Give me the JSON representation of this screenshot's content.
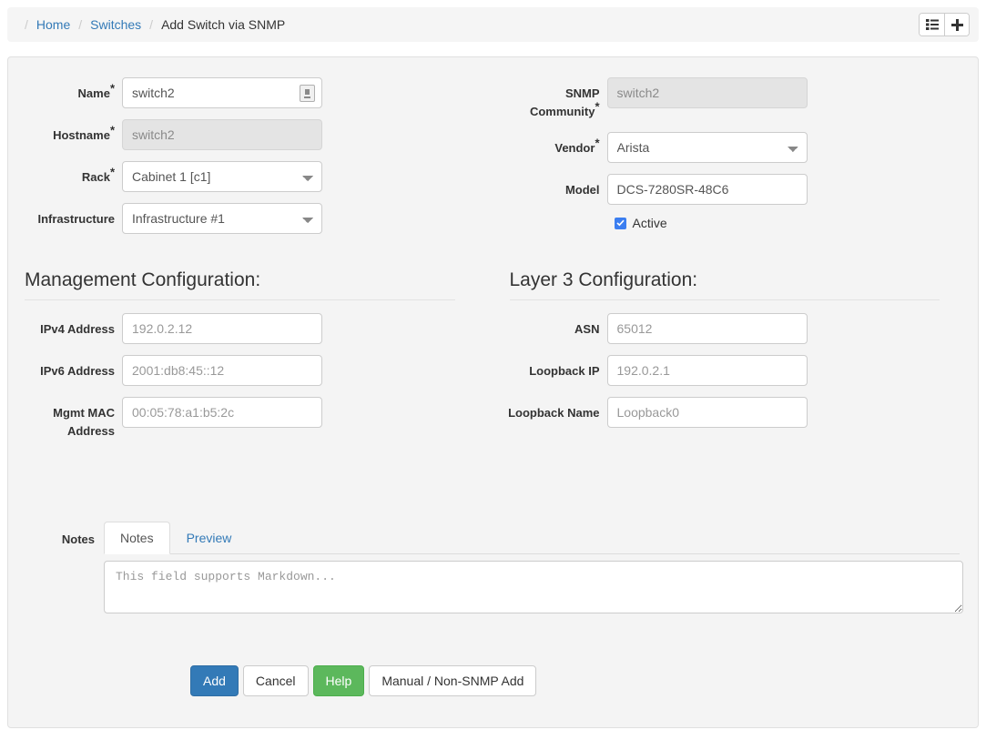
{
  "breadcrumb": {
    "separator": "/",
    "items": [
      {
        "label": "Home",
        "type": "link"
      },
      {
        "label": "Switches",
        "type": "link"
      },
      {
        "label": "Add Switch via SNMP",
        "type": "current"
      }
    ],
    "actions": [
      {
        "name": "list-view-button",
        "icon": "list-icon"
      },
      {
        "name": "add-button",
        "icon": "plus-icon"
      }
    ]
  },
  "form": {
    "left": {
      "name": {
        "label": "Name",
        "required": "*",
        "value": "switch2",
        "placeholder": "",
        "badge_icon": "contact-card-icon"
      },
      "hostname": {
        "label": "Hostname",
        "required": "*",
        "value": "switch2",
        "disabled": true
      },
      "rack": {
        "label": "Rack",
        "required": "*",
        "value": "Cabinet 1 [c1]",
        "options": [
          "Cabinet 1 [c1]"
        ]
      },
      "infrastructure": {
        "label": "Infrastructure",
        "required": "",
        "value": "Infrastructure #1",
        "options": [
          "Infrastructure #1"
        ]
      }
    },
    "right": {
      "snmp_community": {
        "label": "SNMP Community",
        "required": "*",
        "value": "switch2",
        "disabled": true
      },
      "vendor": {
        "label": "Vendor",
        "required": "*",
        "value": "Arista",
        "options": [
          "Arista"
        ]
      },
      "model": {
        "label": "Model",
        "required": "",
        "value": "DCS-7280SR-48C6"
      },
      "active": {
        "label": "Active",
        "checked": true
      }
    }
  },
  "management_section": {
    "title": "Management Configuration:",
    "fields": {
      "ipv4": {
        "label": "IPv4 Address",
        "value": "",
        "placeholder": "192.0.2.12"
      },
      "ipv6": {
        "label": "IPv6 Address",
        "value": "",
        "placeholder": "2001:db8:45::12"
      },
      "mgmt_mac": {
        "label": "Mgmt MAC Address",
        "value": "",
        "placeholder": "00:05:78:a1:b5:2c"
      }
    }
  },
  "layer3_section": {
    "title": "Layer 3 Configuration:",
    "fields": {
      "asn": {
        "label": "ASN",
        "value": "",
        "placeholder": "65012"
      },
      "loopback_ip": {
        "label": "Loopback IP",
        "value": "",
        "placeholder": "192.0.2.1"
      },
      "loopback_name": {
        "label": "Loopback Name",
        "value": "",
        "placeholder": "Loopback0"
      }
    }
  },
  "notes": {
    "label": "Notes",
    "tabs": [
      {
        "label": "Notes",
        "active": true
      },
      {
        "label": "Preview",
        "active": false
      }
    ],
    "textarea": {
      "value": "",
      "placeholder": "This field supports Markdown..."
    }
  },
  "buttons": [
    {
      "label": "Add",
      "style": "primary"
    },
    {
      "label": "Cancel",
      "style": "default"
    },
    {
      "label": "Help",
      "style": "success"
    },
    {
      "label": "Manual / Non-SNMP Add",
      "style": "default"
    }
  ],
  "colors": {
    "link": "#337ab7",
    "primary": "#337ab7",
    "success": "#5cb85c",
    "panel_bg": "#f4f4f4",
    "bar_bg": "#f5f5f5",
    "checkbox": "#3b7ef0"
  }
}
